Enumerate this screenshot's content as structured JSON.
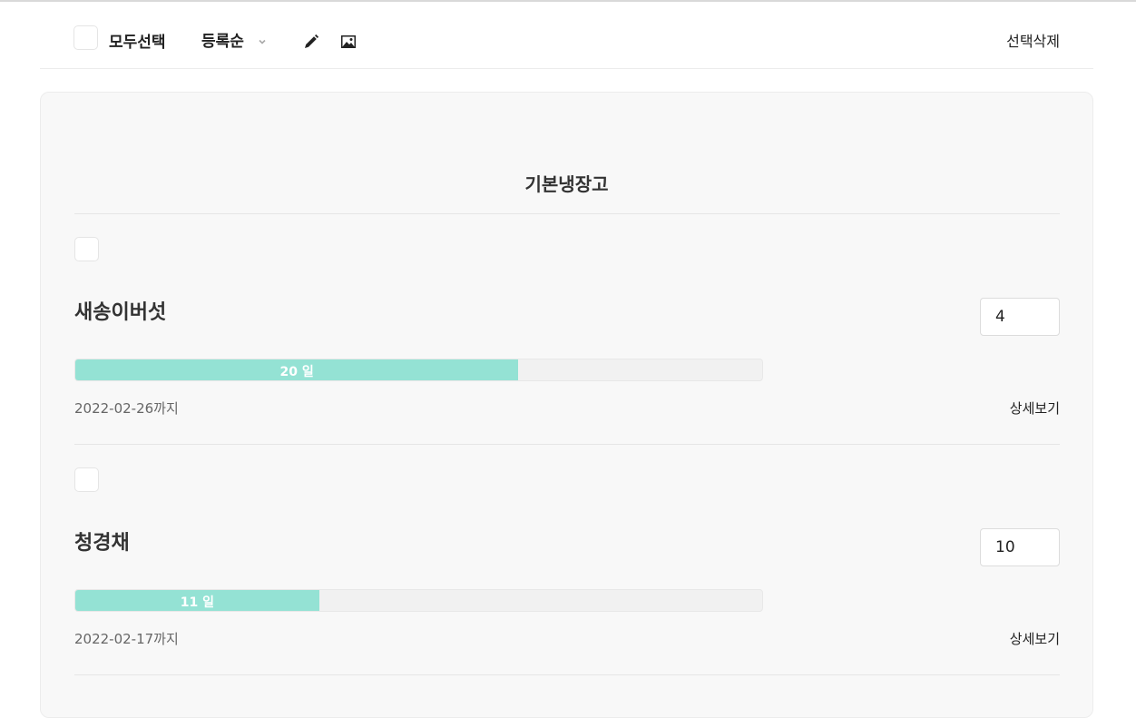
{
  "toolbar": {
    "select_all_label": "모두선택",
    "sort_label": "등록순",
    "delete_selected_label": "선택삭제",
    "icons": {
      "edit": "pencil-icon",
      "image": "image-icon",
      "sort": "chevron-down-icon"
    }
  },
  "fridge": {
    "title": "기본냉장고",
    "items": [
      {
        "name": "새송이버섯",
        "quantity": "4",
        "progress_label": "20 일",
        "progress_percent": 64.5,
        "expiry": "2022-02-26까지",
        "detail_label": "상세보기"
      },
      {
        "name": "청경채",
        "quantity": "10",
        "progress_label": "11 일",
        "progress_percent": 35.5,
        "expiry": "2022-02-17까지",
        "detail_label": "상세보기"
      }
    ]
  },
  "colors": {
    "progress_fill": "#94e2d4",
    "card_background": "#f8f8f8"
  }
}
